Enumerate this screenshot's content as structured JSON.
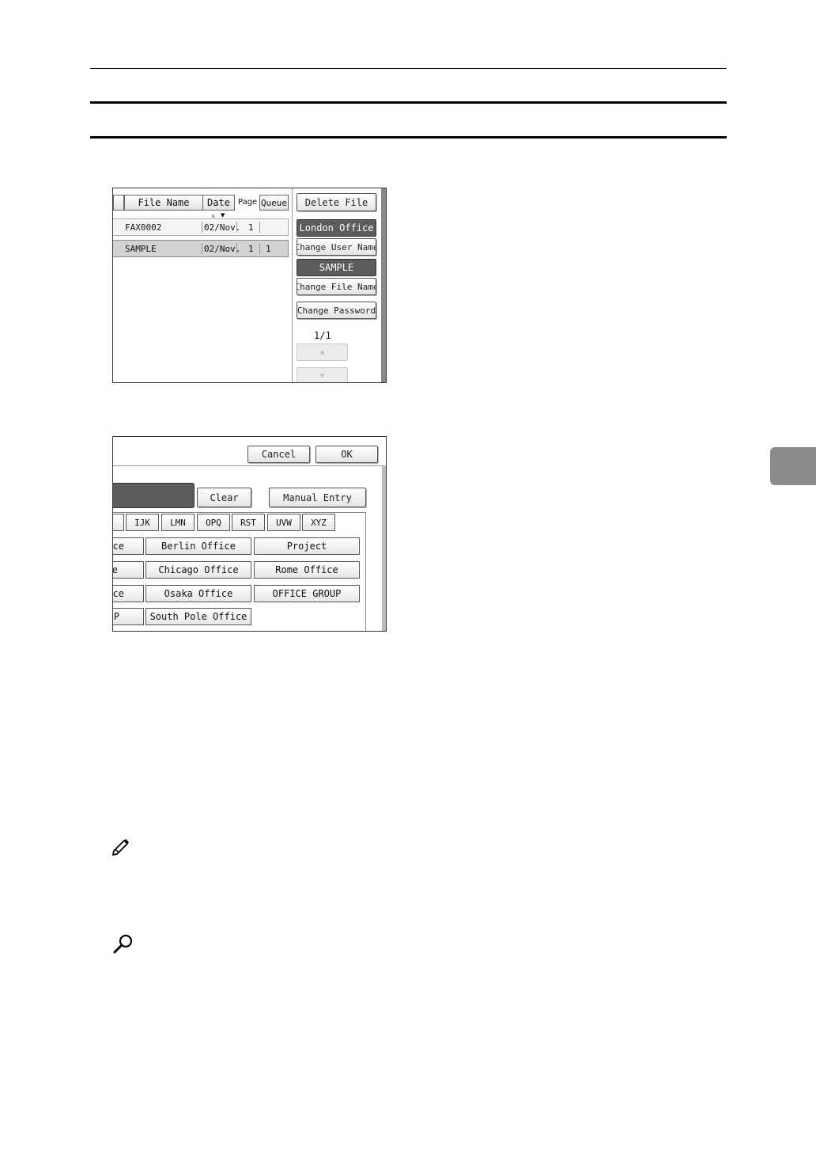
{
  "screen1": {
    "headers": {
      "file_name": "File Name",
      "date": "Date",
      "page": "Page",
      "queue": "Queue"
    },
    "rows": [
      {
        "name": "FAX0002",
        "date": "02/Nov.",
        "page": "1",
        "queue": ""
      },
      {
        "name": "SAMPLE",
        "date": "02/Nov.",
        "page": "1",
        "queue": "1"
      }
    ],
    "buttons": {
      "delete_file": "Delete File",
      "user_name": "London Office",
      "change_user_name": "Change User Name",
      "file_name": "SAMPLE",
      "change_file_name": "Change File Name",
      "change_password": "Change Password"
    },
    "page_indicator": "1/1"
  },
  "screen2": {
    "cancel": "Cancel",
    "ok": "OK",
    "clear": "Clear",
    "manual_entry": "Manual Entry",
    "tabs": [
      "IJK",
      "LMN",
      "OPQ",
      "RST",
      "UVW",
      "XYZ"
    ],
    "left_col": [
      "ce",
      "e",
      "ce",
      "P"
    ],
    "mid_col": [
      "Berlin Office",
      "Chicago Office",
      "Osaka Office",
      "South Pole Office"
    ],
    "right_col": [
      "Project",
      "Rome Office",
      "OFFICE GROUP"
    ]
  },
  "icons": {
    "note": "pencil-icon",
    "reference": "magnifier-icon"
  },
  "colors": {
    "selected_name": "#5c5c5c",
    "thumb_tab": "#8c8c8c"
  }
}
